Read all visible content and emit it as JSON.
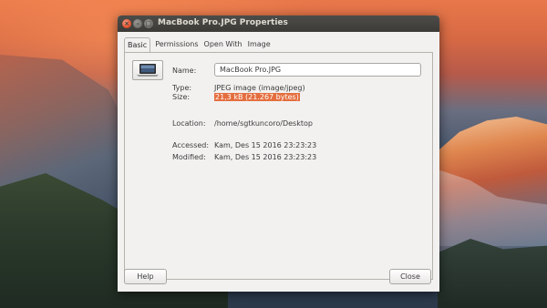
{
  "window": {
    "title": "MacBook Pro.JPG Properties",
    "controls": [
      "close-icon",
      "minimize-icon",
      "maximize-icon"
    ]
  },
  "tabs": [
    {
      "label": "Basic",
      "active": true
    },
    {
      "label": "Permissions",
      "active": false
    },
    {
      "label": "Open With",
      "active": false
    },
    {
      "label": "Image",
      "active": false
    }
  ],
  "basic": {
    "icon": "image-file-icon",
    "name_label": "Name:",
    "name_value": "MacBook Pro.JPG",
    "type_label": "Type:",
    "type_value": "JPEG image (image/jpeg)",
    "size_label": "Size:",
    "size_value": "21,3 kB (21.267 bytes)",
    "location_label": "Location:",
    "location_value": "/home/sgtkuncoro/Desktop",
    "accessed_label": "Accessed:",
    "accessed_value": "Kam, Des 15 2016 23:23:23",
    "modified_label": "Modified:",
    "modified_value": "Kam, Des 15 2016 23:23:23"
  },
  "buttons": {
    "help": "Help",
    "close": "Close"
  },
  "colors": {
    "titlebar": "#3c3b37",
    "close_button": "#e4542f",
    "selection_highlight": "#e46e3e",
    "dialog_bg": "#f2f1f0"
  }
}
